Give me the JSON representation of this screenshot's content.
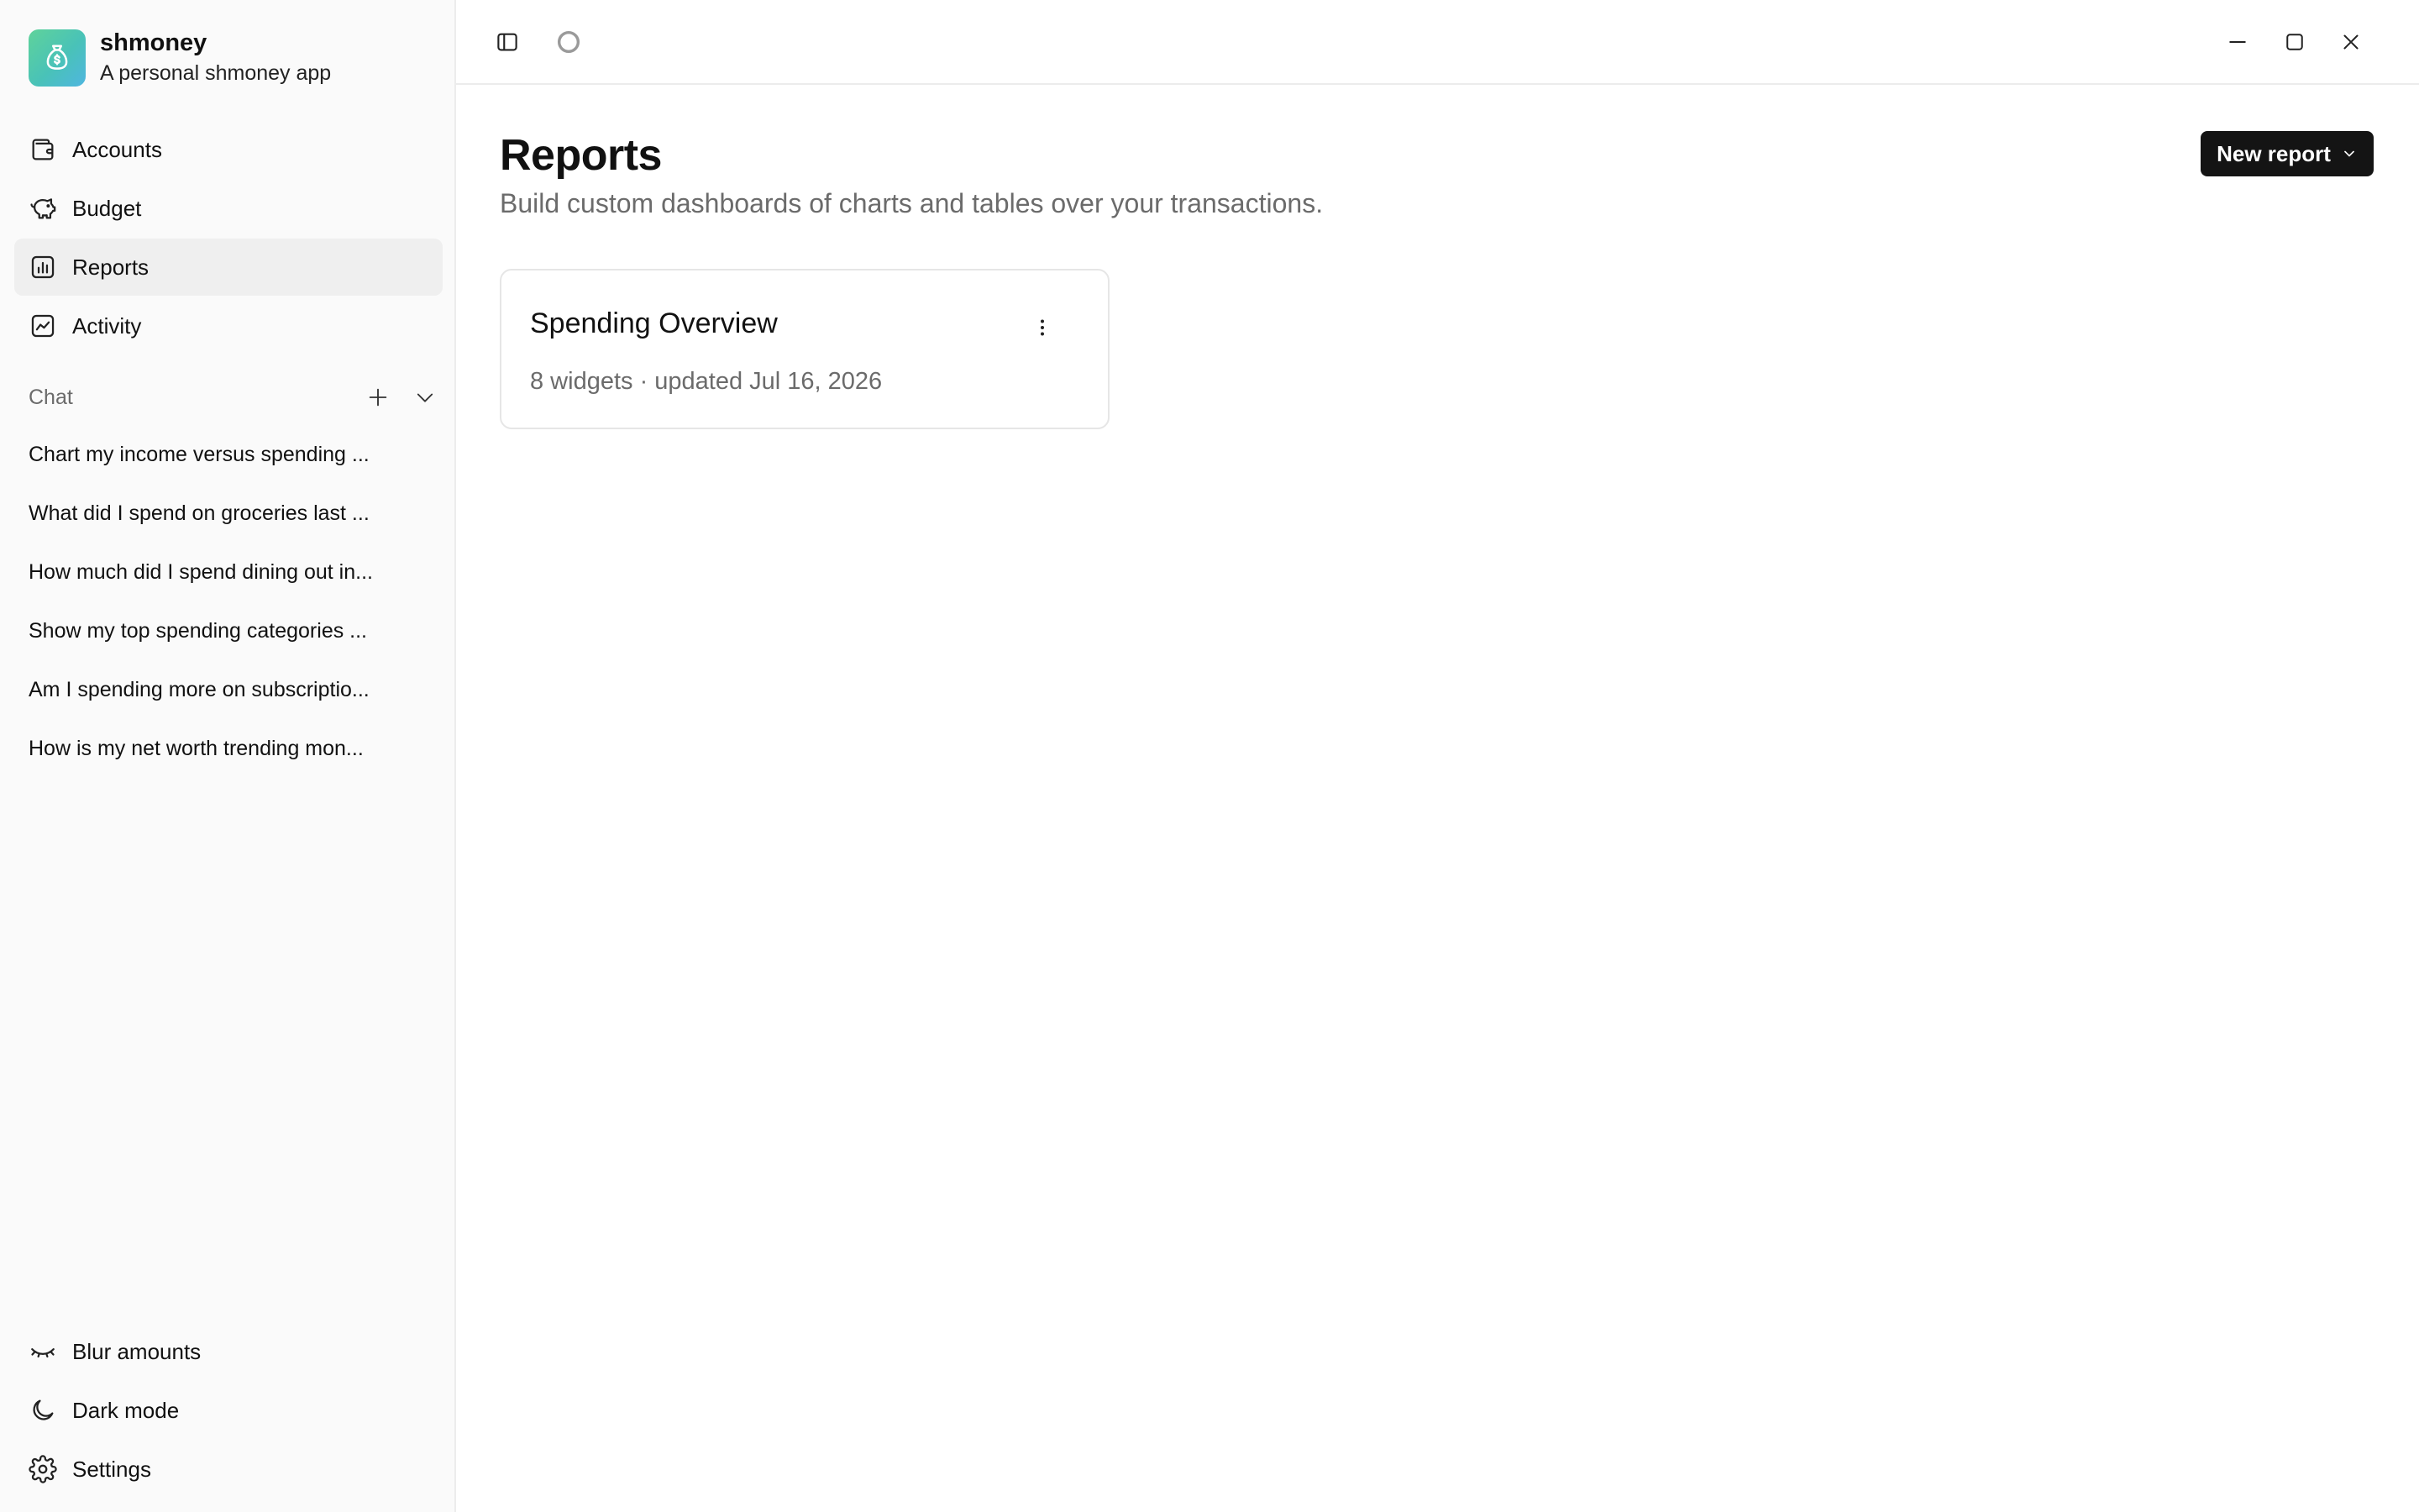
{
  "brand": {
    "name": "shmoney",
    "tagline": "A personal shmoney app",
    "accent_gradient": [
      "#5fd39a",
      "#4fb6e0"
    ]
  },
  "nav": [
    {
      "label": "Accounts",
      "icon": "wallet-icon",
      "active": false
    },
    {
      "label": "Budget",
      "icon": "piggy-bank-icon",
      "active": false
    },
    {
      "label": "Reports",
      "icon": "chart-icon",
      "active": true
    },
    {
      "label": "Activity",
      "icon": "activity-icon",
      "active": false
    }
  ],
  "chat": {
    "title": "Chat",
    "items": [
      "Chart my income versus spending ...",
      "What did I spend on groceries last ...",
      "How much did I spend dining out in...",
      "Show my top spending categories ...",
      "Am I spending more on subscriptio...",
      "How is my net worth trending mon..."
    ]
  },
  "bottom_nav": [
    {
      "label": "Blur amounts",
      "icon": "eye-closed-icon"
    },
    {
      "label": "Dark mode",
      "icon": "moon-icon"
    },
    {
      "label": "Settings",
      "icon": "gear-icon"
    }
  ],
  "page": {
    "title": "Reports",
    "subtitle": "Build custom dashboards of charts and tables over your transactions.",
    "new_report_label": "New report"
  },
  "reports": [
    {
      "title": "Spending Overview",
      "meta": "8 widgets · updated Jul 16, 2026"
    }
  ]
}
